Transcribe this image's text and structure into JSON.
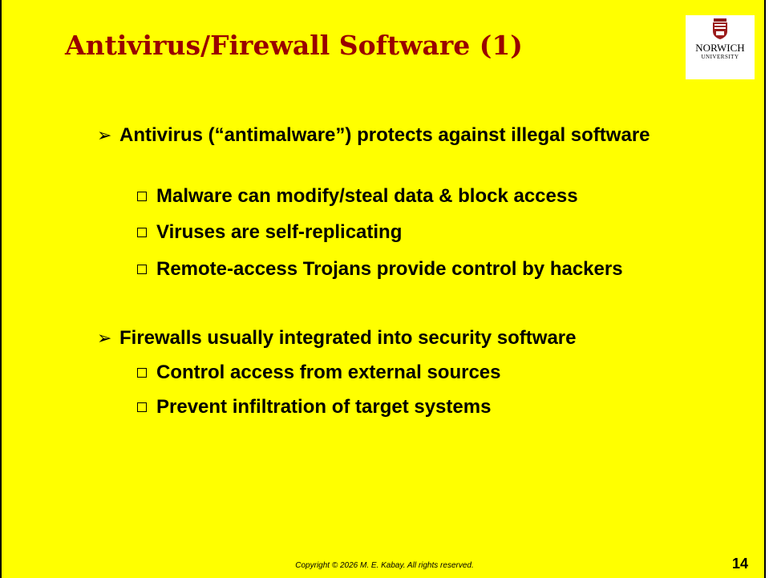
{
  "slide": {
    "title": "Antivirus/Firewall Software (1)",
    "logo": {
      "name": "NORWICH",
      "subtitle": "UNIVERSITY",
      "icon": "norwich-shield-icon",
      "seal_text": "1819"
    },
    "bullets": [
      {
        "marker": "arrow-bullet-icon",
        "text": "Antivirus (“antimalware”) protects against illegal software",
        "subitems": [
          "Malware can modify/steal data & block access",
          "Viruses are self-replicating",
          "Remote-access Trojans provide control by hackers"
        ]
      },
      {
        "marker": "arrow-bullet-icon",
        "text": "Firewalls usually integrated into security software",
        "subitems": [
          "Control access from external sources",
          "Prevent infiltration of target systems"
        ]
      }
    ],
    "footer": {
      "copyright": "Copyright © 2026 M. E. Kabay.  All rights reserved.",
      "page_number": "14"
    },
    "colors": {
      "background": "#ffff00",
      "title": "#990000",
      "text": "#000000"
    }
  }
}
